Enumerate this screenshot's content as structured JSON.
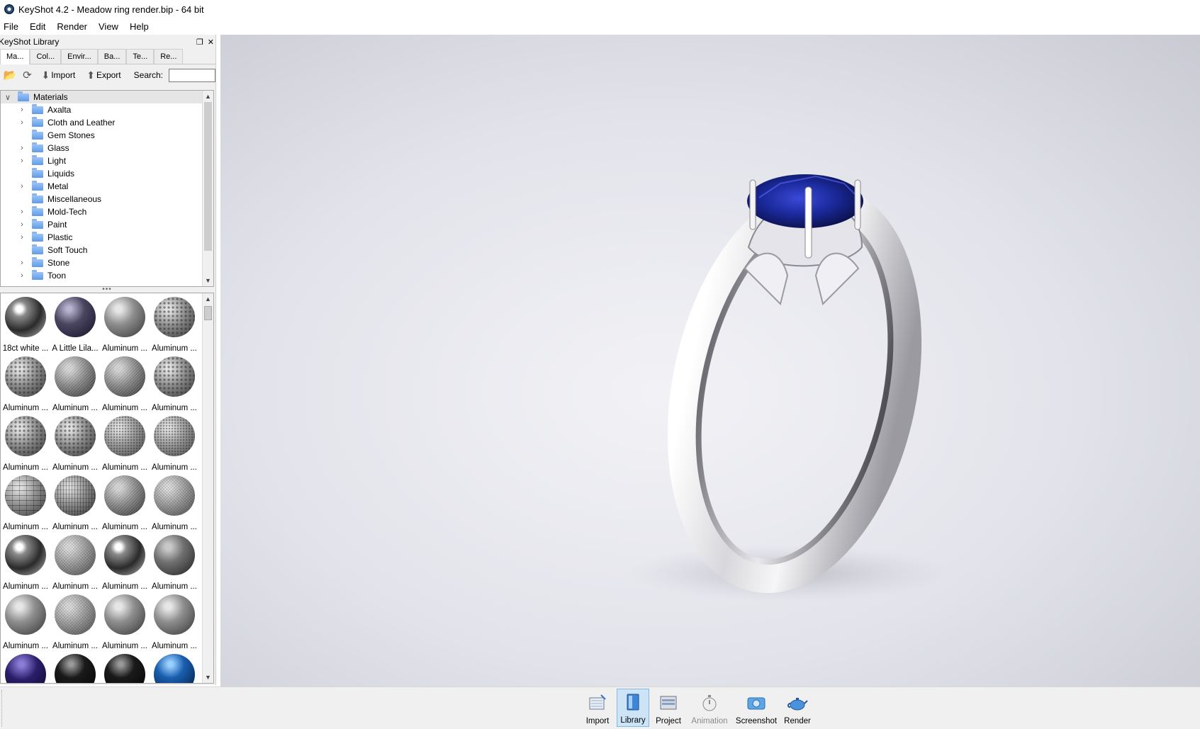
{
  "window": {
    "title": "KeyShot 4.2  - Meadow ring render.bip  - 64 bit"
  },
  "menu": [
    "File",
    "Edit",
    "Render",
    "View",
    "Help"
  ],
  "library": {
    "title": "KeyShot Library",
    "tabs": [
      "Ma...",
      "Col...",
      "Envir...",
      "Ba...",
      "Te...",
      "Re..."
    ],
    "active_tab": "Ma...",
    "toolbar": {
      "import_label": "Import",
      "export_label": "Export",
      "search_label": "Search:",
      "search_value": ""
    },
    "tree": {
      "root": "Materials",
      "items": [
        {
          "label": "Axalta",
          "expandable": true
        },
        {
          "label": "Cloth and Leather",
          "expandable": true
        },
        {
          "label": "Gem Stones",
          "expandable": false
        },
        {
          "label": "Glass",
          "expandable": true
        },
        {
          "label": "Light",
          "expandable": true
        },
        {
          "label": "Liquids",
          "expandable": false
        },
        {
          "label": "Metal",
          "expandable": true
        },
        {
          "label": "Miscellaneous",
          "expandable": false
        },
        {
          "label": "Mold-Tech",
          "expandable": true
        },
        {
          "label": "Paint",
          "expandable": true
        },
        {
          "label": "Plastic",
          "expandable": true
        },
        {
          "label": "Soft Touch",
          "expandable": false
        },
        {
          "label": "Stone",
          "expandable": true
        },
        {
          "label": "Toon",
          "expandable": true
        }
      ]
    },
    "materials": [
      {
        "label": "18ct white ...",
        "style": "chrome-dark"
      },
      {
        "label": "A Little Lila...",
        "style": "lilac"
      },
      {
        "label": "Aluminum ...",
        "style": "grey-smooth"
      },
      {
        "label": "Aluminum ...",
        "style": "dimpled"
      },
      {
        "label": "Aluminum ...",
        "style": "dimpled"
      },
      {
        "label": "Aluminum ...",
        "style": "brushed"
      },
      {
        "label": "Aluminum ...",
        "style": "brushed"
      },
      {
        "label": "Aluminum ...",
        "style": "dimpled"
      },
      {
        "label": "Aluminum ...",
        "style": "dimpled"
      },
      {
        "label": "Aluminum ...",
        "style": "dimpled"
      },
      {
        "label": "Aluminum ...",
        "style": "dimpled-fine"
      },
      {
        "label": "Aluminum ...",
        "style": "dimpled-fine"
      },
      {
        "label": "Aluminum ...",
        "style": "brick"
      },
      {
        "label": "Aluminum ...",
        "style": "mesh"
      },
      {
        "label": "Aluminum ...",
        "style": "brushed"
      },
      {
        "label": "Aluminum ...",
        "style": "mesh-fine"
      },
      {
        "label": "Aluminum ...",
        "style": "chrome-dark"
      },
      {
        "label": "Aluminum ...",
        "style": "mesh-fine"
      },
      {
        "label": "Aluminum ...",
        "style": "chrome-dark"
      },
      {
        "label": "Aluminum ...",
        "style": "grey-dark"
      },
      {
        "label": "Aluminum ...",
        "style": "grey-smooth"
      },
      {
        "label": "Aluminum ...",
        "style": "mesh-fine"
      },
      {
        "label": "Aluminum ...",
        "style": "grey-smooth"
      },
      {
        "label": "Aluminum ...",
        "style": "grey-smooth"
      },
      {
        "label": "",
        "style": "purple-dark"
      },
      {
        "label": "",
        "style": "black"
      },
      {
        "label": "",
        "style": "black"
      },
      {
        "label": "",
        "style": "blue-dark"
      }
    ]
  },
  "dock": [
    {
      "label": "Import",
      "icon": "import-icon",
      "active": false,
      "disabled": false
    },
    {
      "label": "Library",
      "icon": "library-icon",
      "active": true,
      "disabled": false
    },
    {
      "label": "Project",
      "icon": "project-icon",
      "active": false,
      "disabled": false
    },
    {
      "label": "Animation",
      "icon": "animation-icon",
      "active": false,
      "disabled": true
    },
    {
      "label": "Screenshot",
      "icon": "screenshot-icon",
      "active": false,
      "disabled": false
    },
    {
      "label": "Render",
      "icon": "render-teapot-icon",
      "active": false,
      "disabled": false
    }
  ],
  "viewport": {
    "subject": "silver-ring-with-blue-sapphire"
  }
}
